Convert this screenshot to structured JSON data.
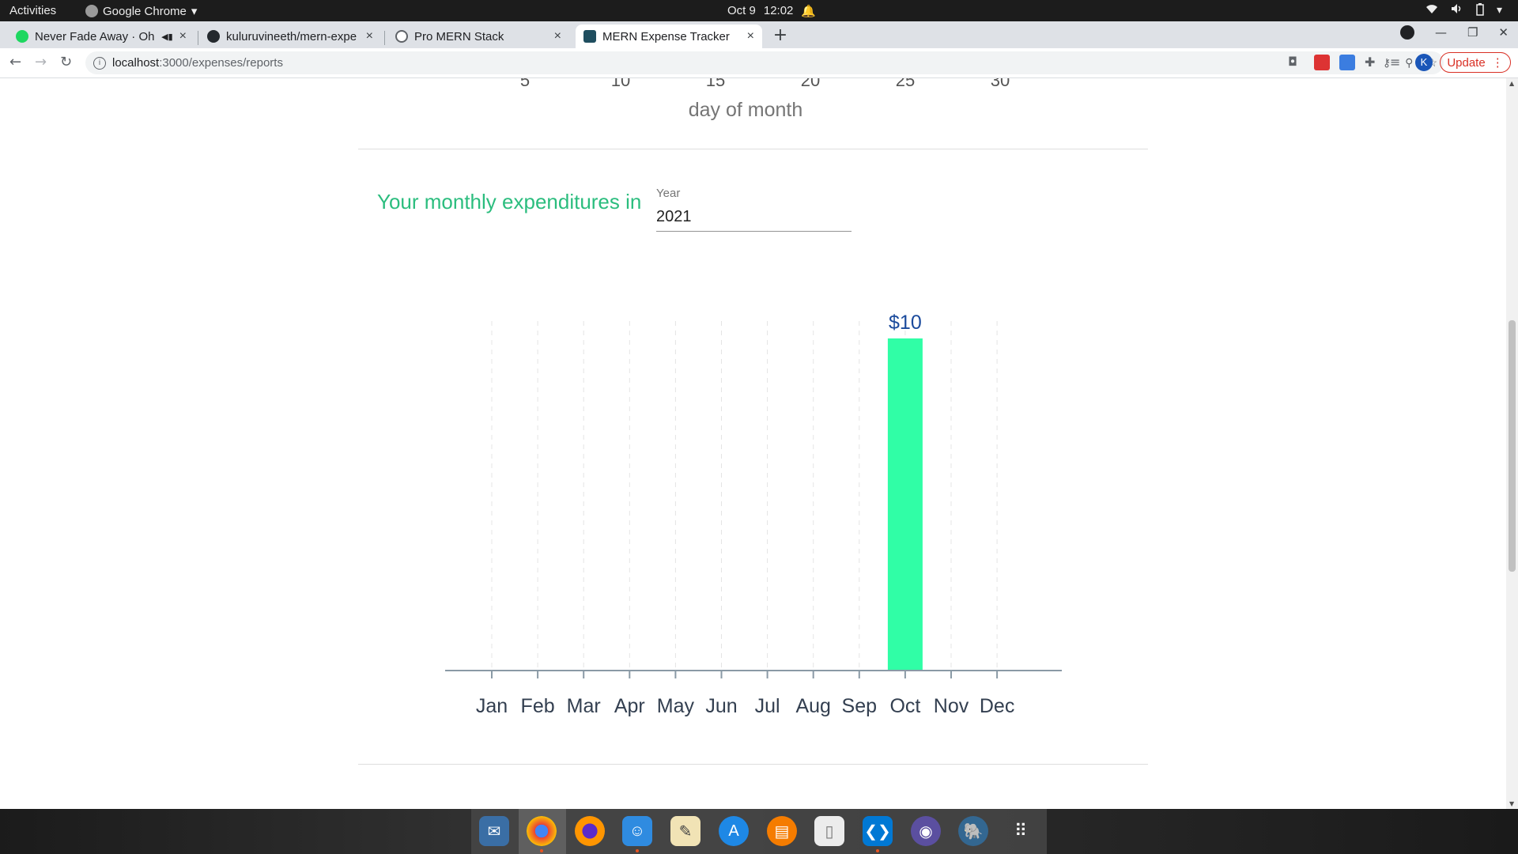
{
  "system_bar": {
    "activities": "Activities",
    "app_name": "Google Chrome",
    "app_menu_arrow": "▾",
    "date": "Oct 9",
    "time": "12:02",
    "status_icons": [
      "wifi-icon",
      "volume-icon",
      "battery-icon",
      "power-menu-icon"
    ]
  },
  "tabs": [
    {
      "title": "Never Fade Away · Oh",
      "icon": "spotify-icon",
      "active": false,
      "audio": true
    },
    {
      "title": "kuluruvineeth/mern-expe",
      "icon": "github-icon",
      "active": false
    },
    {
      "title": "Pro MERN Stack",
      "icon": "globe-icon",
      "active": false
    },
    {
      "title": "MERN Expense Tracker",
      "icon": "app-icon",
      "active": true
    }
  ],
  "tab_close_glyph": "×",
  "new_tab_glyph": "+",
  "address_bar": {
    "url_host": "localhost",
    "url_path": ":3000/expenses/reports"
  },
  "update_button": "Update",
  "profile_initial": "K",
  "previous_chart": {
    "tick_labels": [
      "5",
      "10",
      "15",
      "20",
      "25",
      "30"
    ],
    "axis_label": "day of month"
  },
  "monthly": {
    "heading": "Your monthly expenditures in",
    "year_label": "Year",
    "year_value": "2021"
  },
  "colors": {
    "heading_green": "#2bbd7e",
    "bar_fill": "#30fea6",
    "value_label": "#1a4a9c",
    "axis_text": "#333f50"
  },
  "chart_data": {
    "type": "bar",
    "categories": [
      "Jan",
      "Feb",
      "Mar",
      "Apr",
      "May",
      "Jun",
      "Jul",
      "Aug",
      "Sep",
      "Oct",
      "Nov",
      "Dec"
    ],
    "values": [
      0,
      0,
      0,
      0,
      0,
      0,
      0,
      0,
      0,
      10,
      0,
      0
    ],
    "data_labels": [
      "",
      "",
      "",
      "",
      "",
      "",
      "",
      "",
      "",
      "$10",
      "",
      ""
    ],
    "title": "",
    "xlabel": "",
    "ylabel": "",
    "grid": "vertical dashed"
  },
  "dock_apps": [
    "screenshot-app",
    "chrome",
    "firefox",
    "files",
    "notes",
    "app-store",
    "books",
    "text-editor",
    "vscode",
    "github-desktop",
    "postgres",
    "app-grid"
  ]
}
